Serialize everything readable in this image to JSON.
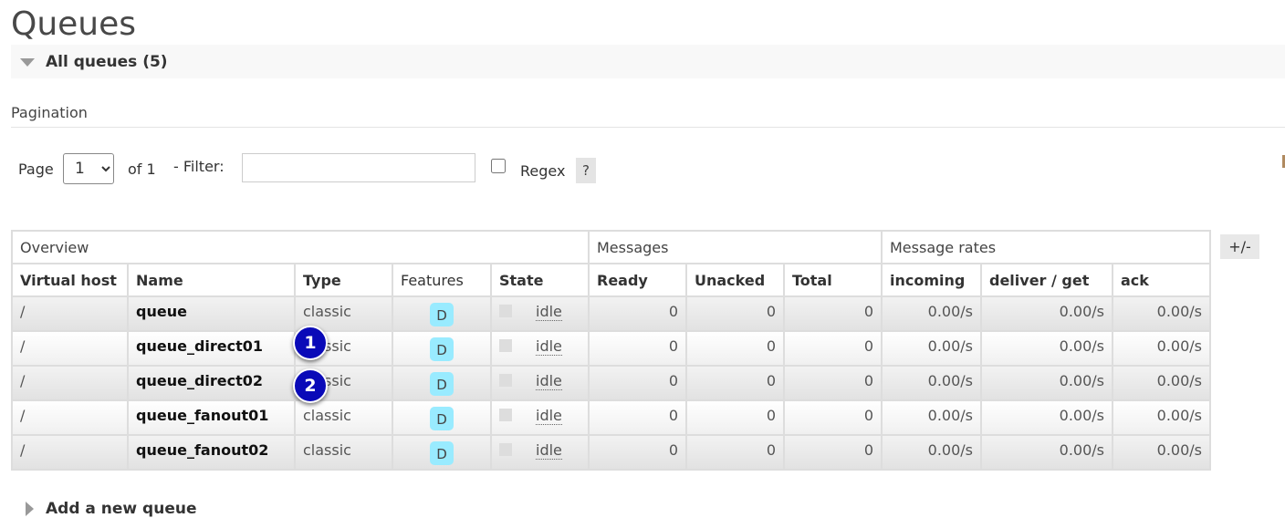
{
  "page": {
    "title": "Queues"
  },
  "section": {
    "label": "All queues (5)",
    "expanded": true
  },
  "pagination": {
    "heading": "Pagination",
    "page_label": "Page",
    "page_value": "1",
    "page_options": [
      "1"
    ],
    "of_label": "of 1",
    "filter_label": "- Filter:",
    "filter_value": "",
    "filter_placeholder": "",
    "regex_label": "Regex",
    "regex_checked": false,
    "help_label": "?"
  },
  "table": {
    "groups": [
      "Overview",
      "Messages",
      "Message rates"
    ],
    "columns": [
      "Virtual host",
      "Name",
      "Type",
      "Features",
      "State",
      "Ready",
      "Unacked",
      "Total",
      "incoming",
      "deliver / get",
      "ack"
    ],
    "toggle_label": "+/-",
    "rows": [
      {
        "vhost": "/",
        "name": "queue",
        "type": "classic",
        "feature": "D",
        "state": "idle",
        "ready": "0",
        "unacked": "0",
        "total": "0",
        "incoming": "0.00/s",
        "deliver_get": "0.00/s",
        "ack": "0.00/s"
      },
      {
        "vhost": "/",
        "name": "queue_direct01",
        "type": "classic",
        "feature": "D",
        "state": "idle",
        "ready": "0",
        "unacked": "0",
        "total": "0",
        "incoming": "0.00/s",
        "deliver_get": "0.00/s",
        "ack": "0.00/s"
      },
      {
        "vhost": "/",
        "name": "queue_direct02",
        "type": "classic",
        "feature": "D",
        "state": "idle",
        "ready": "0",
        "unacked": "0",
        "total": "0",
        "incoming": "0.00/s",
        "deliver_get": "0.00/s",
        "ack": "0.00/s"
      },
      {
        "vhost": "/",
        "name": "queue_fanout01",
        "type": "classic",
        "feature": "D",
        "state": "idle",
        "ready": "0",
        "unacked": "0",
        "total": "0",
        "incoming": "0.00/s",
        "deliver_get": "0.00/s",
        "ack": "0.00/s"
      },
      {
        "vhost": "/",
        "name": "queue_fanout02",
        "type": "classic",
        "feature": "D",
        "state": "idle",
        "ready": "0",
        "unacked": "0",
        "total": "0",
        "incoming": "0.00/s",
        "deliver_get": "0.00/s",
        "ack": "0.00/s"
      }
    ]
  },
  "markers": [
    "1",
    "2"
  ],
  "add_section": {
    "label": "Add a new queue",
    "expanded": false
  },
  "colors": {
    "feature_badge": "#99ebff",
    "marker": "#0a0ab8"
  }
}
